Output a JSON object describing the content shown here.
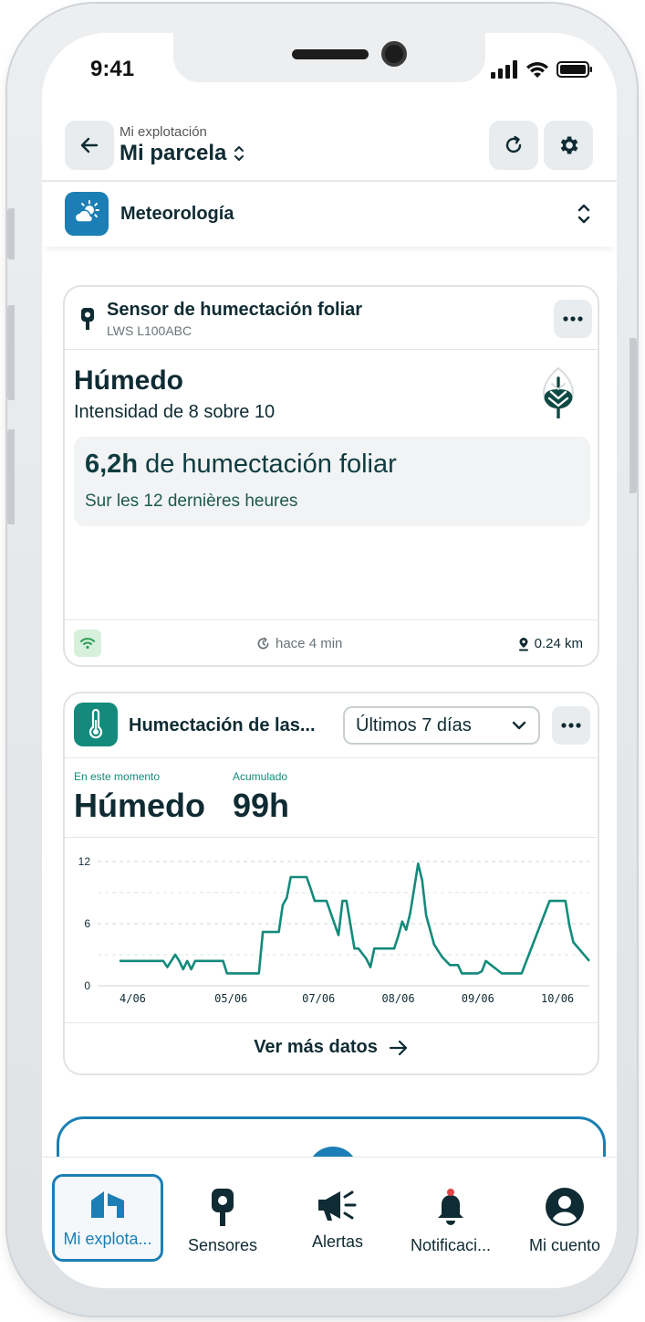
{
  "status_bar": {
    "time": "9:41"
  },
  "header": {
    "crumb": "Mi explotación",
    "title": "Mi parcela"
  },
  "section": {
    "label": "Meteorología"
  },
  "sensor_card": {
    "title": "Sensor de humectación foliar",
    "subtitle": "LWS L100ABC",
    "state": "Húmedo",
    "intensity": "Intensidad de 8 sobre 10",
    "hours_value": "6,2h",
    "hours_label": "de humectación foliar",
    "period": "Sur les 12 dernières heures",
    "updated": "hace 4 min",
    "distance": "0.24 km"
  },
  "history_card": {
    "title": "Humectación de las...",
    "period_select": "Últimos 7 días",
    "now_label": "En este momento",
    "now_value": "Húmedo",
    "acc_label": "Acumulado",
    "acc_value": "99h",
    "more_label": "Ver más datos"
  },
  "chart_data": {
    "type": "line",
    "ylim": [
      0,
      12
    ],
    "yticks": [
      0,
      6,
      12
    ],
    "xtick_labels": [
      "4/06",
      "05/06",
      "07/06",
      "08/06",
      "09/06",
      "10/06"
    ],
    "xtick_positions": [
      0.5,
      1.9,
      3.0,
      4.0,
      5.0,
      6.0
    ],
    "xlim": [
      0.5,
      6.4
    ],
    "color": "#138a7b",
    "series": [
      {
        "x": [
          0.5,
          1.05,
          1.1,
          1.15,
          1.2,
          1.25,
          1.3,
          1.35,
          1.4,
          1.45,
          1.8,
          1.85,
          2.25,
          2.3,
          2.5,
          2.55,
          2.6,
          2.65,
          2.85,
          2.9,
          2.95,
          3.1,
          3.25,
          3.3,
          3.35,
          3.45,
          3.5,
          3.6,
          3.65,
          3.7,
          3.95,
          4.0,
          4.05,
          4.1,
          4.15,
          4.2,
          4.25,
          4.3,
          4.35,
          4.45,
          4.55,
          4.65,
          4.75,
          4.8,
          5.0,
          5.05,
          5.1,
          5.3,
          5.55,
          5.9,
          6.0,
          6.1,
          6.15,
          6.2,
          6.4
        ],
        "y": [
          2.4,
          2.4,
          1.8,
          2.4,
          3.0,
          2.4,
          1.6,
          2.4,
          1.6,
          2.4,
          2.4,
          1.2,
          1.2,
          5.2,
          5.2,
          7.8,
          8.5,
          10.5,
          10.5,
          9.4,
          8.2,
          8.2,
          4.9,
          8.2,
          8.2,
          3.6,
          3.6,
          2.6,
          1.8,
          3.6,
          3.6,
          4.8,
          6.2,
          5.4,
          7.0,
          9.4,
          11.8,
          10.2,
          6.8,
          4.0,
          2.8,
          2.0,
          2.0,
          1.2,
          1.2,
          1.4,
          2.4,
          1.2,
          1.2,
          8.2,
          8.2,
          8.2,
          5.8,
          4.2,
          2.4
        ]
      }
    ]
  },
  "nav": {
    "items": [
      {
        "label": "Mi explota..."
      },
      {
        "label": "Sensores"
      },
      {
        "label": "Alertas"
      },
      {
        "label": "Notificaci..."
      },
      {
        "label": "Mi cuento"
      }
    ]
  },
  "colors": {
    "accent": "#1b7fb5",
    "teal": "#138a7b",
    "text": "#0f2b33"
  }
}
